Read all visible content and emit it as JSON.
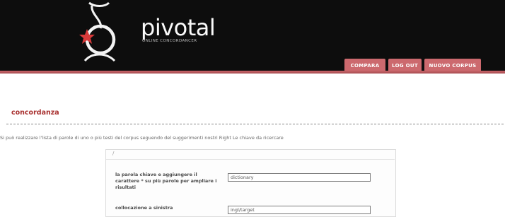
{
  "header": {
    "logo_text": "pivotal",
    "logo_subtitle": "online concordancer",
    "colors": {
      "background": "#0d0d0d",
      "accent": "#cc696e",
      "star": "#d93a3a"
    }
  },
  "nav": {
    "tabs": [
      {
        "label": "COMPARA"
      },
      {
        "label": "LOG OUT"
      },
      {
        "label": "NUOVO CORPUS"
      }
    ]
  },
  "main": {
    "title": "concordanza",
    "instruction": "Si può realizzare l'lista di parole di uno o più testi del corpus seguendo del suggerimenti nostri Right Le chiave da ricercare",
    "panel_tick": "/",
    "form": {
      "fields": [
        {
          "label": "la parola chiave e aggiungere il carattere * su più parole per ampliare i risultati",
          "value": "dictionary"
        },
        {
          "label": "collocazione a sinistra",
          "value": "ingl/target"
        }
      ]
    }
  }
}
